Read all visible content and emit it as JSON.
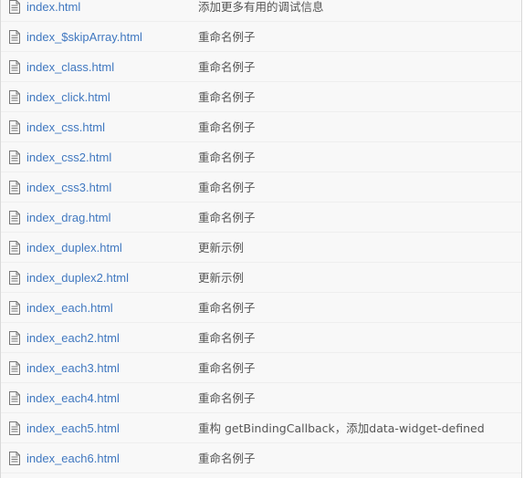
{
  "files": [
    {
      "name": "index.html",
      "message": "添加更多有用的调试信息",
      "icon": "file-text-icon"
    },
    {
      "name": "index_$skipArray.html",
      "message": "重命名例子",
      "icon": "file-text-icon"
    },
    {
      "name": "index_class.html",
      "message": "重命名例子",
      "icon": "file-text-icon"
    },
    {
      "name": "index_click.html",
      "message": "重命名例子",
      "icon": "file-text-icon"
    },
    {
      "name": "index_css.html",
      "message": "重命名例子",
      "icon": "file-text-icon"
    },
    {
      "name": "index_css2.html",
      "message": "重命名例子",
      "icon": "file-text-icon"
    },
    {
      "name": "index_css3.html",
      "message": "重命名例子",
      "icon": "file-text-icon"
    },
    {
      "name": "index_drag.html",
      "message": "重命名例子",
      "icon": "file-text-icon"
    },
    {
      "name": "index_duplex.html",
      "message": "更新示例",
      "icon": "file-text-icon"
    },
    {
      "name": "index_duplex2.html",
      "message": "更新示例",
      "icon": "file-text-icon"
    },
    {
      "name": "index_each.html",
      "message": "重命名例子",
      "icon": "file-text-icon"
    },
    {
      "name": "index_each2.html",
      "message": "重命名例子",
      "icon": "file-text-icon"
    },
    {
      "name": "index_each3.html",
      "message": "重命名例子",
      "icon": "file-text-icon"
    },
    {
      "name": "index_each4.html",
      "message": "重命名例子",
      "icon": "file-text-icon"
    },
    {
      "name": "index_each5.html",
      "message": "重构 getBindingCallback，添加data-widget-defined",
      "icon": "file-text-icon"
    },
    {
      "name": "index_each6.html",
      "message": "重命名例子",
      "icon": "file-text-icon"
    }
  ],
  "colors": {
    "link": "#4078c0",
    "message": "#555555",
    "row_bg": "#f8f8f8",
    "row_border": "#eeeeee",
    "icon": "#777777"
  }
}
